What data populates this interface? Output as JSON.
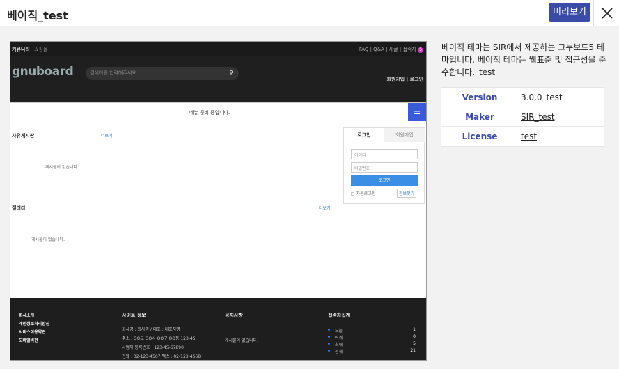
{
  "header": {
    "title": "베이직_test",
    "preview_label": "미리보기"
  },
  "screenshot": {
    "top_left_a": "커뮤니티",
    "top_left_b": "쇼핑몰",
    "top_right": "FAQ  |  Q&A  |  새글  |  접속자",
    "visitor_badge": "5",
    "logo": "gnuboard",
    "search_placeholder": "검색어를 입력해주세요",
    "header_links": "회원가입  |  로그인",
    "menu_notice": "메뉴 준비 중입니다.",
    "free_board": "자유게시판",
    "gallery": "갤러리",
    "more": "더보기",
    "empty": "게시물이 없습니다.",
    "login": {
      "tab_login": "로그인",
      "tab_join": "회원가입",
      "id_placeholder": "아이디",
      "pw_placeholder": "비밀번호",
      "button": "로그인",
      "auto_login": "자동로그인",
      "find_info": "정보찾기"
    },
    "footer": {
      "links": [
        "회사소개",
        "개인정보처리방침",
        "서비스이용약관",
        "모바일버전"
      ],
      "site_info_title": "사이트 정보",
      "site_info_lines": [
        "회사명 : 회사명 / 대표 : 대표자명",
        "주소 : OO도 OO시 OO구 OO동 123-45",
        "사업자 등록번호 : 123-45-67890",
        "전화 : 02-123-4567  팩스 : 02-123-4568"
      ],
      "notice_title": "공지사항",
      "notice_empty": "게시물이 없습니다.",
      "stats_title": "접속자집계",
      "stats": [
        {
          "label": "오늘",
          "value": "1"
        },
        {
          "label": "어제",
          "value": "0"
        },
        {
          "label": "최대",
          "value": "5"
        },
        {
          "label": "전체",
          "value": "21"
        }
      ]
    }
  },
  "description": "베이직 테마는 SIR에서 제공하는 그누보드5 테마입니다. 베이직 테마는 웹표준 및 접근성을 준수합니다._test",
  "info": [
    {
      "key": "Version",
      "value": "3.0.0_test"
    },
    {
      "key": "Maker",
      "value": "SIR_test"
    },
    {
      "key": "License",
      "value": "test"
    }
  ],
  "colors": {
    "accent": "#3a4ba8",
    "menu": "#3a5bd9"
  }
}
